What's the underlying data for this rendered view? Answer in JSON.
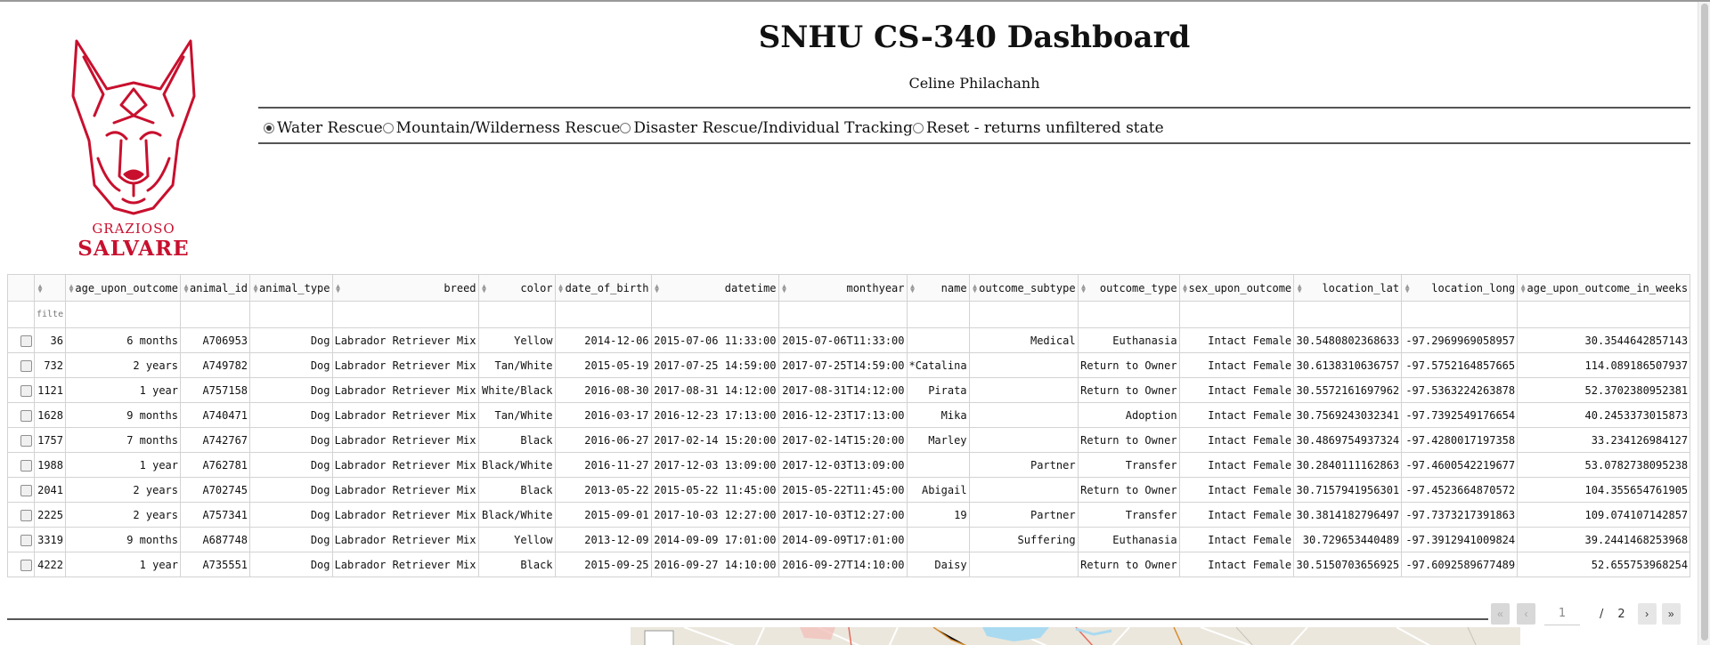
{
  "header": {
    "title": "SNHU CS-340 Dashboard",
    "author": "Celine Philachanh"
  },
  "logo": {
    "line1": "GRAZIOSO",
    "line2": "SALVARE",
    "color": "#c8102e"
  },
  "filters": {
    "selected": "Water Rescue",
    "options": [
      "Water Rescue",
      "Mountain/Wilderness Rescue",
      "Disaster Rescue/Individual Tracking",
      "Reset - returns unfiltered state"
    ]
  },
  "table": {
    "filter_placeholder": "filter data...",
    "columns": [
      "",
      "age_upon_outcome",
      "animal_id",
      "animal_type",
      "breed",
      "color",
      "date_of_birth",
      "datetime",
      "monthyear",
      "name",
      "outcome_subtype",
      "outcome_type",
      "sex_upon_outcome",
      "location_lat",
      "location_long",
      "age_upon_outcome_in_weeks"
    ],
    "rows": [
      [
        "36",
        "6 months",
        "A706953",
        "Dog",
        "Labrador Retriever Mix",
        "Yellow",
        "2014-12-06",
        "2015-07-06 11:33:00",
        "2015-07-06T11:33:00",
        "",
        "Medical",
        "Euthanasia",
        "Intact Female",
        "30.5480802368633",
        "-97.2969969058957",
        "30.3544642857143"
      ],
      [
        "732",
        "2 years",
        "A749782",
        "Dog",
        "Labrador Retriever Mix",
        "Tan/White",
        "2015-05-19",
        "2017-07-25 14:59:00",
        "2017-07-25T14:59:00",
        "*Catalina",
        "",
        "Return to Owner",
        "Intact Female",
        "30.6138310636757",
        "-97.5752164857665",
        "114.089186507937"
      ],
      [
        "1121",
        "1 year",
        "A757158",
        "Dog",
        "Labrador Retriever Mix",
        "White/Black",
        "2016-08-30",
        "2017-08-31 14:12:00",
        "2017-08-31T14:12:00",
        "Pirata",
        "",
        "Return to Owner",
        "Intact Female",
        "30.5572161697962",
        "-97.5363224263878",
        "52.3702380952381"
      ],
      [
        "1628",
        "9 months",
        "A740471",
        "Dog",
        "Labrador Retriever Mix",
        "Tan/White",
        "2016-03-17",
        "2016-12-23 17:13:00",
        "2016-12-23T17:13:00",
        "Mika",
        "",
        "Adoption",
        "Intact Female",
        "30.7569243032341",
        "-97.7392549176654",
        "40.2453373015873"
      ],
      [
        "1757",
        "7 months",
        "A742767",
        "Dog",
        "Labrador Retriever Mix",
        "Black",
        "2016-06-27",
        "2017-02-14 15:20:00",
        "2017-02-14T15:20:00",
        "Marley",
        "",
        "Return to Owner",
        "Intact Female",
        "30.4869754937324",
        "-97.4280017197358",
        "33.234126984127"
      ],
      [
        "1988",
        "1 year",
        "A762781",
        "Dog",
        "Labrador Retriever Mix",
        "Black/White",
        "2016-11-27",
        "2017-12-03 13:09:00",
        "2017-12-03T13:09:00",
        "",
        "Partner",
        "Transfer",
        "Intact Female",
        "30.2840111162863",
        "-97.4600542219677",
        "53.0782738095238"
      ],
      [
        "2041",
        "2 years",
        "A702745",
        "Dog",
        "Labrador Retriever Mix",
        "Black",
        "2013-05-22",
        "2015-05-22 11:45:00",
        "2015-05-22T11:45:00",
        "Abigail",
        "",
        "Return to Owner",
        "Intact Female",
        "30.7157941956301",
        "-97.4523664870572",
        "104.355654761905"
      ],
      [
        "2225",
        "2 years",
        "A757341",
        "Dog",
        "Labrador Retriever Mix",
        "Black/White",
        "2015-09-01",
        "2017-10-03 12:27:00",
        "2017-10-03T12:27:00",
        "19",
        "Partner",
        "Transfer",
        "Intact Female",
        "30.3814182796497",
        "-97.7373217391863",
        "109.074107142857"
      ],
      [
        "3319",
        "9 months",
        "A687748",
        "Dog",
        "Labrador Retriever Mix",
        "Yellow",
        "2013-12-09",
        "2014-09-09 17:01:00",
        "2014-09-09T17:01:00",
        "",
        "Suffering",
        "Euthanasia",
        "Intact Female",
        "30.729653440489",
        "-97.3912941009824",
        "39.2441468253968"
      ],
      [
        "4222",
        "1 year",
        "A735551",
        "Dog",
        "Labrador Retriever Mix",
        "Black",
        "2015-09-25",
        "2016-09-27 14:10:00",
        "2016-09-27T14:10:00",
        "Daisy",
        "",
        "Return to Owner",
        "Intact Female",
        "30.5150703656925",
        "-97.6092589677489",
        "52.655753968254"
      ]
    ]
  },
  "pagination": {
    "current": "1",
    "separator": "/",
    "total": "2",
    "first_label": "«",
    "prev_label": "‹",
    "next_label": "›",
    "last_label": "»"
  }
}
